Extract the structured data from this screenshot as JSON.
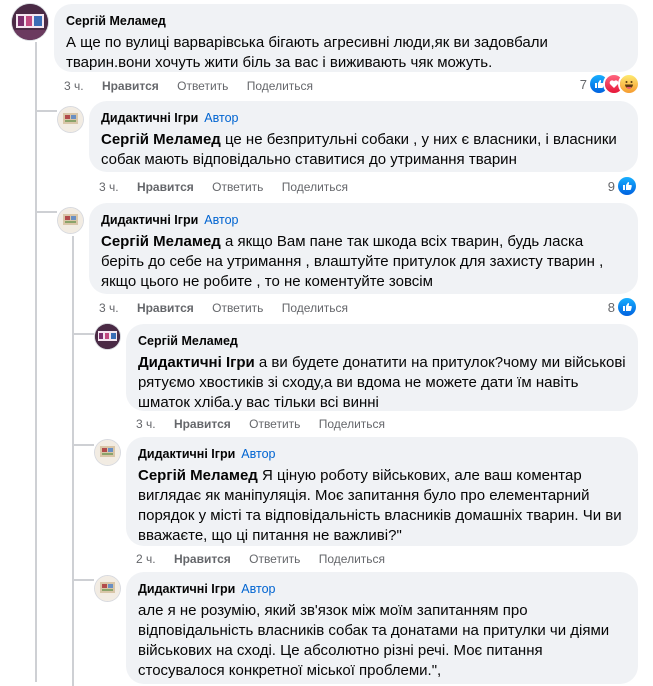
{
  "comments": [
    {
      "author": "Сергій Меламед",
      "badge": "",
      "mention": "",
      "text": "А ще по вулиці варварівська бігають агресивні люди,як ви задовбали тварин.вони хочуть жити біль за вас і виживають чяк можуть.",
      "time": "3 ч.",
      "like_label": "Нравится",
      "reply_label": "Ответить",
      "share_label": "Поделиться",
      "reaction_count": "7",
      "reactions": [
        "like-icon",
        "love-icon",
        "haha-icon"
      ]
    },
    {
      "author": "Дидактичні Ігри",
      "badge": "Автор",
      "mention": "Сергій Меламед",
      "text": " це не безпритульні собаки , у них є власники, і власники собак мають відповідально ставитися до утримання тварин",
      "time": "3 ч.",
      "like_label": "Нравится",
      "reply_label": "Ответить",
      "share_label": "Поделиться",
      "reaction_count": "9",
      "reactions": [
        "like-icon"
      ]
    },
    {
      "author": "Дидактичні Ігри",
      "badge": "Автор",
      "mention": "Сергій Меламед",
      "text": " а якщо Вам пане так шкода всіх тварин, будь ласка беріть до себе на утримання , влаштуйте притулок для захисту тварин , якщо цього не робите , то не коментуйте зовсім",
      "time": "3 ч.",
      "like_label": "Нравится",
      "reply_label": "Ответить",
      "share_label": "Поделиться",
      "reaction_count": "8",
      "reactions": [
        "like-icon"
      ]
    },
    {
      "author": "Сергій Меламед",
      "badge": "",
      "mention": "Дидактичні Ігри",
      "text": " а ви будете донатити на притулок?чому ми військові рятуємо хвостиків зі сходу,а ви вдома не можете дати їм навіть шматок хліба.у вас тільки всі винні",
      "time": "3 ч.",
      "like_label": "Нравится",
      "reply_label": "Ответить",
      "share_label": "Поделиться",
      "reaction_count": "",
      "reactions": []
    },
    {
      "author": "Дидактичні Ігри",
      "badge": "Автор",
      "mention": "Сергій Меламед",
      "text": " Я ціную роботу військових, але ваш коментар виглядає як маніпуляція. Моє запитання було про елементарний порядок у місті та відповідальність власників домашніх тварин. Чи ви вважаєте, що ці питання не важливі?\"",
      "time": "2 ч.",
      "like_label": "Нравится",
      "reply_label": "Ответить",
      "share_label": "Поделиться",
      "reaction_count": "",
      "reactions": []
    },
    {
      "author": "Дидактичні Ігри",
      "badge": "Автор",
      "mention": "",
      "text": "але я не розумію, який зв'язок між моїм запитанням про відповідальність власників собак та донатами на притулки чи діями військових на сході. Це абсолютно різні речі. Моє питання стосувалося конкретної міської проблеми.\",",
      "time": "",
      "like_label": "",
      "reply_label": "",
      "share_label": "",
      "reaction_count": "",
      "reactions": []
    }
  ],
  "colors": {
    "bubble": "#f0f2f5",
    "badge": "#0064d1",
    "meta": "#65676b",
    "like_reaction": "#1877f2",
    "love_reaction": "#f33e58",
    "haha_reaction": "#f7b125"
  }
}
